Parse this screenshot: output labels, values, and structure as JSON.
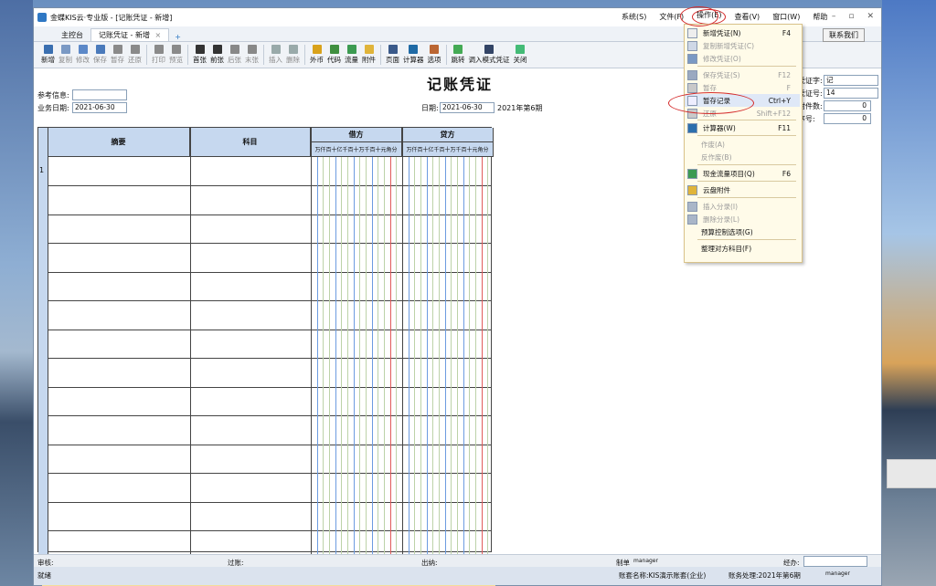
{
  "window": {
    "title": "金蝶KIS云·专业版 - [记账凭证 - 新增]"
  },
  "menu": {
    "items": [
      "系统(S)",
      "文件(F)",
      "操作(E)",
      "查看(V)",
      "窗口(W)",
      "帮助"
    ]
  },
  "tabs": {
    "items": [
      "主控台",
      "记账凭证 - 新增"
    ],
    "close": "×",
    "add": "+"
  },
  "contact_button": "联系我们",
  "toolbar": [
    {
      "label": "新增",
      "enabled": true
    },
    {
      "label": "复制",
      "enabled": false
    },
    {
      "label": "修改",
      "enabled": false
    },
    {
      "label": "保存",
      "enabled": false
    },
    {
      "label": "暂存",
      "enabled": false
    },
    {
      "label": "还原",
      "enabled": false
    },
    {
      "label": "打印",
      "enabled": false
    },
    {
      "label": "预览",
      "enabled": false
    },
    {
      "label": "首张",
      "enabled": true
    },
    {
      "label": "前张",
      "enabled": true
    },
    {
      "label": "后张",
      "enabled": false
    },
    {
      "label": "末张",
      "enabled": false
    },
    {
      "label": "插入",
      "enabled": false
    },
    {
      "label": "删除",
      "enabled": false
    },
    {
      "label": "外币",
      "enabled": true
    },
    {
      "label": "代码",
      "enabled": true
    },
    {
      "label": "流量",
      "enabled": true
    },
    {
      "label": "附件",
      "enabled": true
    },
    {
      "label": "页面",
      "enabled": true
    },
    {
      "label": "计算器",
      "enabled": true
    },
    {
      "label": "选项",
      "enabled": true
    },
    {
      "label": "跳转",
      "enabled": true
    },
    {
      "label": "调入模式凭证",
      "enabled": true
    },
    {
      "label": "关闭",
      "enabled": true
    }
  ],
  "voucher": {
    "title": "记账凭证",
    "ref_label": "参考信息:",
    "biz_date_label": "业务日期:",
    "biz_date": "2021-06-30",
    "date_label": "日期:",
    "date": "2021-06-30",
    "period": "2021年第6期",
    "word_label": "凭证字:",
    "word": "记",
    "number_label": "凭证号:",
    "number": "14",
    "attach_label": "附件数:",
    "attach": "0",
    "seq_label": "序号:",
    "seq": "0"
  },
  "grid": {
    "headers": {
      "summary": "摘要",
      "account": "科目",
      "debit": "借方",
      "credit": "贷方"
    },
    "digit_headers": "万仟百十亿千百十万千百十元角分",
    "first_row_index": "1",
    "debit_total": "000",
    "credit_total": "000"
  },
  "footer": {
    "audit": "审核:",
    "post": "过账:",
    "cashier": "出纳:",
    "maker_label": "制单",
    "maker": "manager",
    "handler": "经办:"
  },
  "status": {
    "left": "就绪",
    "account": "账套名称:KIS演示账套(企业)",
    "period": "账务处理:2021年第6期",
    "user": "manager"
  },
  "dropdown": [
    {
      "label": "新增凭证(N)",
      "shortcut": "F4",
      "enabled": true
    },
    {
      "label": "复制新增凭证(C)",
      "shortcut": "",
      "enabled": false
    },
    {
      "label": "修改凭证(O)",
      "shortcut": "",
      "enabled": false
    },
    {
      "label": "保存凭证(S)",
      "shortcut": "F12",
      "enabled": false
    },
    {
      "label": "暂存",
      "shortcut": "F",
      "enabled": false
    },
    {
      "label": "暂存记录",
      "shortcut": "Ctrl+Y",
      "enabled": true
    },
    {
      "label": "还原",
      "shortcut": "Shift+F12",
      "enabled": false
    },
    {
      "label": "计算器(W)",
      "shortcut": "F11",
      "enabled": true
    },
    {
      "label": "作废(A)",
      "shortcut": "",
      "enabled": false
    },
    {
      "label": "反作废(B)",
      "shortcut": "",
      "enabled": false
    },
    {
      "label": "现金流量项目(Q)",
      "shortcut": "F6",
      "enabled": true
    },
    {
      "label": "云盘附件",
      "shortcut": "",
      "enabled": true
    },
    {
      "label": "插入分录(I)",
      "shortcut": "",
      "enabled": false
    },
    {
      "label": "删除分录(L)",
      "shortcut": "",
      "enabled": false
    },
    {
      "label": "预算控制选项(G)",
      "shortcut": "",
      "enabled": true
    },
    {
      "label": "整理对方科目(F)",
      "shortcut": "",
      "enabled": true
    }
  ],
  "colors": {
    "accent": "#2f78c4",
    "header": "#c6d8ef",
    "total": "#f4dc9a",
    "highlight": "#d42a2a"
  }
}
